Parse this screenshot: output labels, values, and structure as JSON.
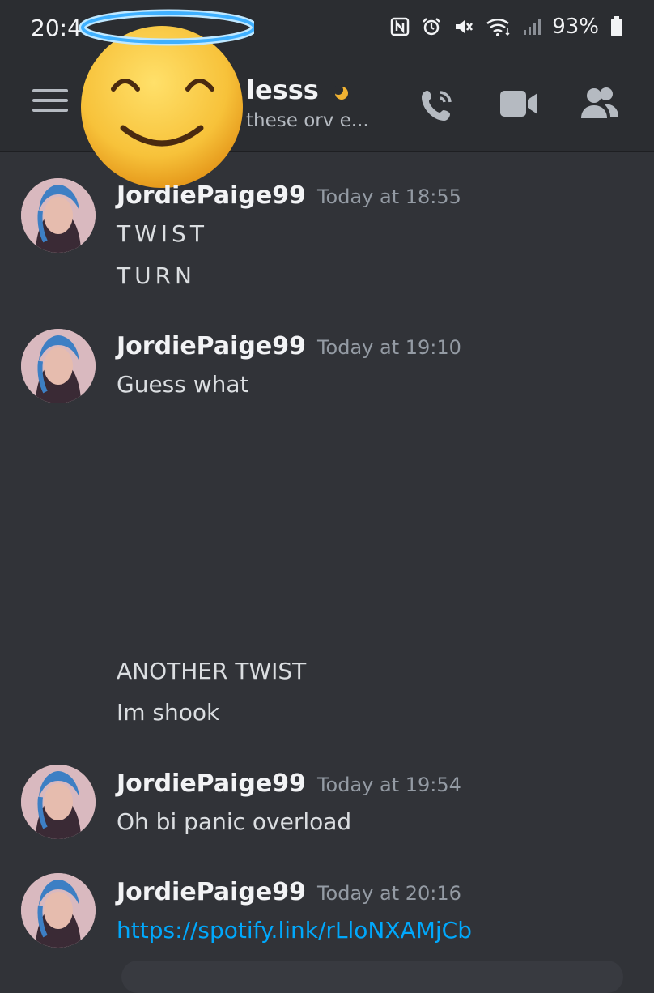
{
  "status_bar": {
    "time": "20:4",
    "battery": "93%"
  },
  "header": {
    "channel_name": "lesss",
    "channel_subtitle": "these orv e..."
  },
  "icons": {
    "menu": "hamburger-menu-icon",
    "call": "phone-call-icon",
    "video": "video-camera-icon",
    "members": "members-icon",
    "overlay": "smiling-face-with-halo-emoji"
  },
  "messages": [
    {
      "author": "JordiePaige99",
      "timestamp": "Today at 18:55",
      "lines": [
        "TWIST",
        "TURN"
      ]
    },
    {
      "author": "JordiePaige99",
      "timestamp": "Today at 19:10",
      "lines": [
        "Guess what"
      ]
    },
    {
      "author": "",
      "timestamp": "",
      "lines": [
        "ANOTHER TWIST",
        "Im shook"
      ]
    },
    {
      "author": "JordiePaige99",
      "timestamp": "Today at 19:54",
      "lines": [
        "Oh bi panic overload"
      ]
    },
    {
      "author": "JordiePaige99",
      "timestamp": "Today at 20:16",
      "lines": [
        "https://spotify.link/rLloNXAMjCb"
      ]
    }
  ],
  "colors": {
    "background": "#313338",
    "header": "#2b2d31",
    "link": "#00a8fc",
    "status_accent": "#f0b232"
  }
}
